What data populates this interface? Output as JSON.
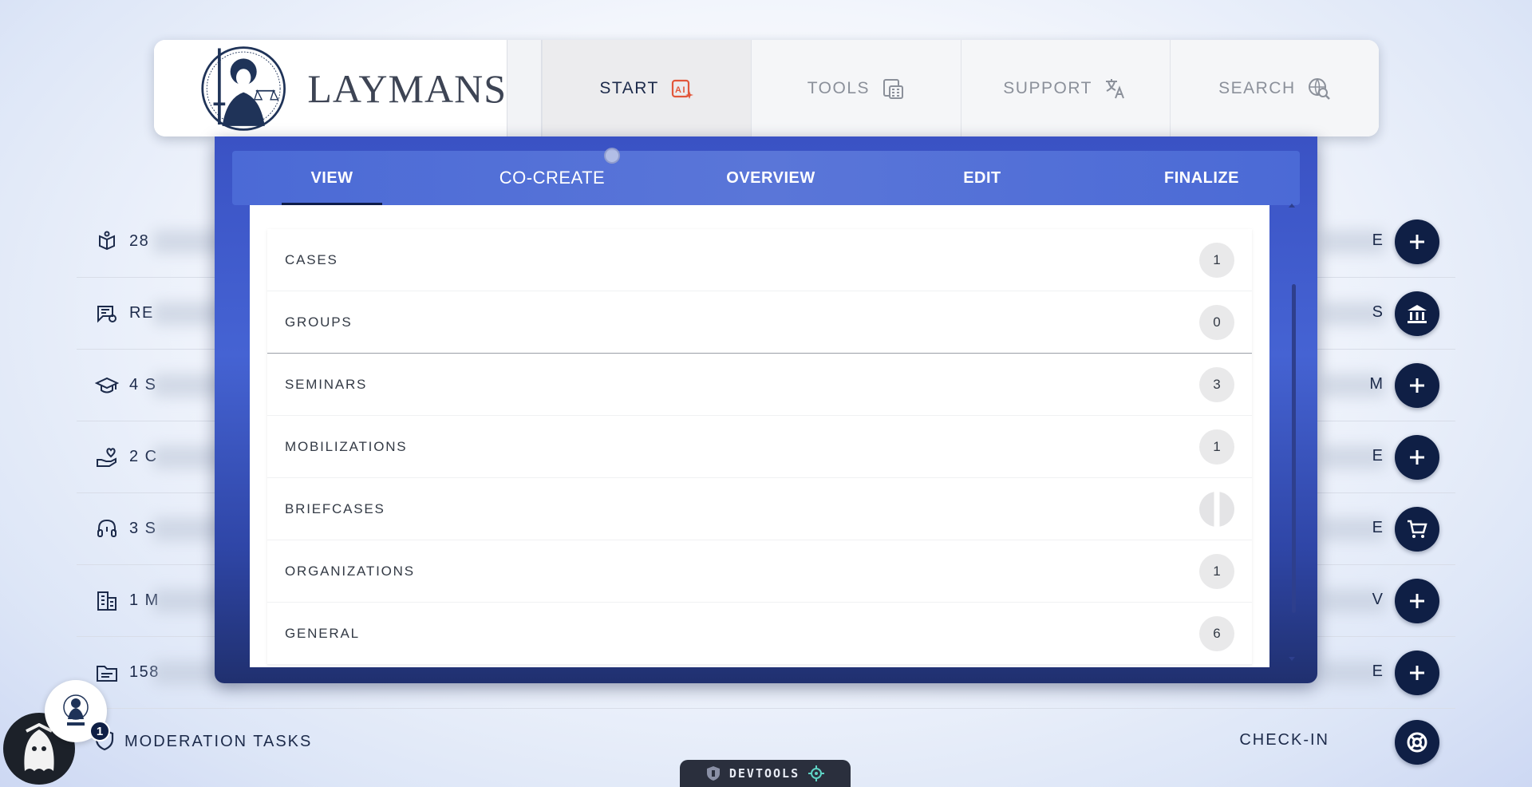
{
  "nav": {
    "brand": "LAYMANS",
    "tabs": [
      {
        "label": "START",
        "icon": "ai-sparkle-icon"
      },
      {
        "label": "TOOLS",
        "icon": "calculator-icon"
      },
      {
        "label": "SUPPORT",
        "icon": "translate-icon"
      },
      {
        "label": "SEARCH",
        "icon": "search-globe-icon"
      }
    ]
  },
  "modal": {
    "tabs": [
      "VIEW",
      "CO-CREATE",
      "OVERVIEW",
      "EDIT",
      "FINALIZE"
    ],
    "active_tab": "VIEW",
    "items": [
      {
        "label": "CASES",
        "count": "1"
      },
      {
        "label": "GROUPS",
        "count": "0"
      },
      {
        "label": "SEMINARS",
        "count": "3"
      },
      {
        "label": "MOBILIZATIONS",
        "count": "1"
      },
      {
        "label": "BRIEFCASES",
        "count": ""
      },
      {
        "label": "ORGANIZATIONS",
        "count": "1"
      },
      {
        "label": "GENERAL",
        "count": "6"
      }
    ]
  },
  "background_rows": [
    {
      "prefix": "28",
      "tail": "E",
      "icon": "book-hand-icon",
      "action": "plus-icon"
    },
    {
      "prefix": "RE",
      "tail": "S",
      "icon": "certificate-icon",
      "action": "bank-icon"
    },
    {
      "prefix": "4 S",
      "tail": "M",
      "icon": "graduation-cap-icon",
      "action": "plus-icon"
    },
    {
      "prefix": "2 C",
      "tail": "E",
      "icon": "heart-hand-icon",
      "action": "plus-icon"
    },
    {
      "prefix": "3 S",
      "tail": "E",
      "icon": "headset-icon",
      "action": "cart-icon"
    },
    {
      "prefix": "1 M",
      "tail": "V",
      "icon": "building-icon",
      "action": "plus-icon"
    },
    {
      "prefix": "158",
      "tail": "E",
      "icon": "folder-icon",
      "action": "plus-icon"
    }
  ],
  "footer": {
    "moderation_label": "MODERATION TASKS",
    "checkin_label": "CHECK-IN",
    "notification_count": "1",
    "devtools_label": "DEVTOOLS"
  },
  "colors": {
    "navy": "#0f1f45",
    "modal_blue": "#4563d3",
    "ai_orange": "#e2573b"
  }
}
